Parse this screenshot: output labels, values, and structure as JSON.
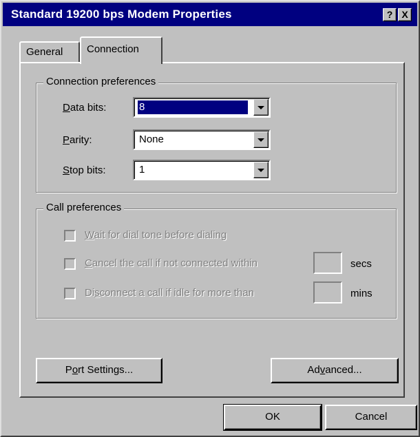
{
  "window": {
    "title": "Standard 19200 bps Modem Properties",
    "help_button": "?",
    "close_button": "X"
  },
  "tabs": [
    {
      "label": "General",
      "selected": false
    },
    {
      "label": "Connection",
      "selected": true
    }
  ],
  "connection_preferences": {
    "legend": "Connection preferences",
    "data_bits": {
      "label_mnemonic": "D",
      "label_rest": "ata bits:",
      "value": "8"
    },
    "parity": {
      "label_mnemonic": "P",
      "label_rest": "arity:",
      "value": "None"
    },
    "stop_bits": {
      "label_mnemonic": "S",
      "label_rest": "top bits:",
      "value": "1"
    }
  },
  "call_preferences": {
    "legend": "Call preferences",
    "wait_dial_tone": {
      "mnemonic": "W",
      "rest": "ait for dial tone before dialing",
      "checked": false
    },
    "cancel_call": {
      "mnemonic": "C",
      "rest": "ancel the call if not connected within",
      "value": "",
      "unit": "secs",
      "checked": false
    },
    "disconnect_idle": {
      "pre": "Di",
      "mnemonic": "s",
      "rest": "connect a call if idle for more than",
      "value": "",
      "unit": "mins",
      "checked": false
    }
  },
  "buttons": {
    "port_settings": {
      "pre": "P",
      "mnemonic": "o",
      "rest": "rt Settings..."
    },
    "advanced": {
      "pre": "Ad",
      "mnemonic": "v",
      "rest": "anced..."
    },
    "ok": "OK",
    "cancel": "Cancel"
  }
}
